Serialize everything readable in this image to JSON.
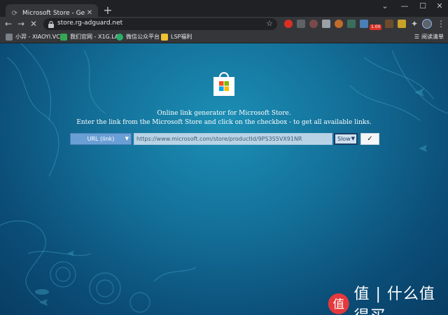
{
  "browser": {
    "tab_title": "Microsoft Store - Generation P",
    "address": "store.rg-adguard.net",
    "extension_badge": "1.00",
    "window_controls": {
      "minimize": "—",
      "maximize": "☐",
      "close": "✕"
    }
  },
  "bookmarks": [
    {
      "label": "小羿 - XIAOYI.VC",
      "color": "#7b7f86"
    },
    {
      "label": "我们官网 - X1G.LA",
      "color": "#34a853"
    },
    {
      "label": "微信公众平台",
      "color": "#2aae67"
    },
    {
      "label": "LSP福利",
      "color": "#f1c232"
    }
  ],
  "reading_list_label": "阅读清单",
  "page": {
    "headline_line1": "Online link generator for Microsoft Store.",
    "headline_line2": "Enter the link from the Microsoft Store and click on the checkbox - to get all available links.",
    "type_select_value": "URL (link)",
    "url_input_value": "https://www.microsoft.com/store/productId/9PS3S5VX91NR",
    "ring_select_value": "Slow",
    "submit_label": "✓"
  },
  "watermark": {
    "text": "值 | 什么值得买",
    "logo_glyph": "值"
  },
  "colors": {
    "brand_ms_red": "#f25022",
    "brand_ms_green": "#7fba00",
    "brand_ms_blue": "#00a4ef",
    "brand_ms_yellow": "#ffb900",
    "watermark_red": "#e4393c"
  }
}
